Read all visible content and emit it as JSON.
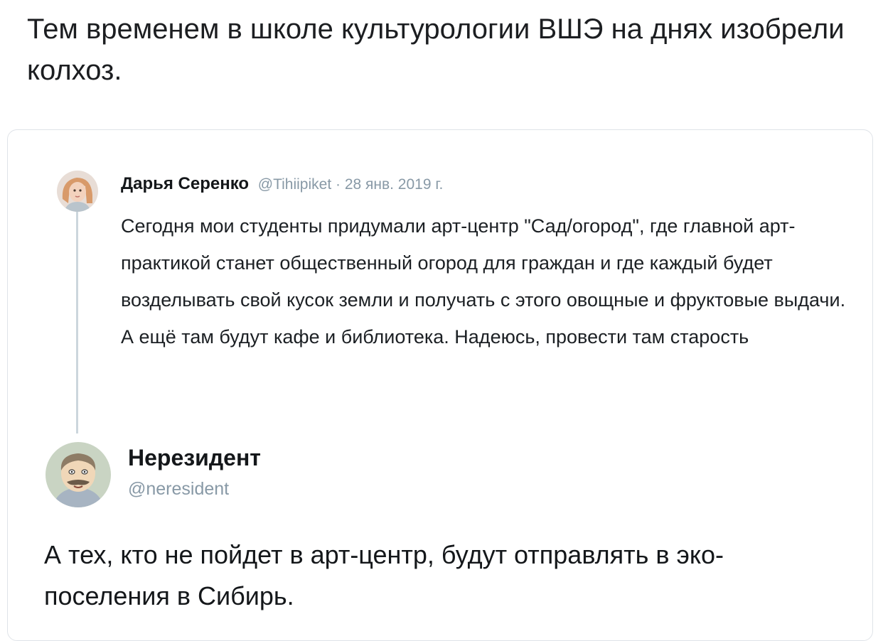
{
  "post": {
    "text": "Тем временем в школе культурологии ВШЭ на днях изобрели колхоз."
  },
  "quoted_tweet": {
    "author_name": "Дарья Серенко",
    "meta": "@Tihiipiket · 28 янв. 2019 г.",
    "text": "Сегодня мои студенты придумали арт-центр \"Сад/огород\", где главной арт-практикой станет общественный огород для граждан и где каждый будет возделывать свой кусок земли и получать с этого овощные и фруктовые выдачи. А ещё там будут кафе и библиотека. Надеюсь, провести там старость",
    "avatar_icon": "user-avatar-woman"
  },
  "reply_tweet": {
    "author_name": "Нерезидент",
    "handle": "@neresident",
    "text": "А тех, кто не пойдет в арт-центр, будут отправлять в эко-поселения в Сибирь.",
    "avatar_icon": "user-avatar-cartoon-man"
  },
  "colors": {
    "text_primary": "#14171a",
    "text_secondary": "#8899a6",
    "border": "#dfe3e8",
    "thread_line": "#ccd6dd"
  }
}
